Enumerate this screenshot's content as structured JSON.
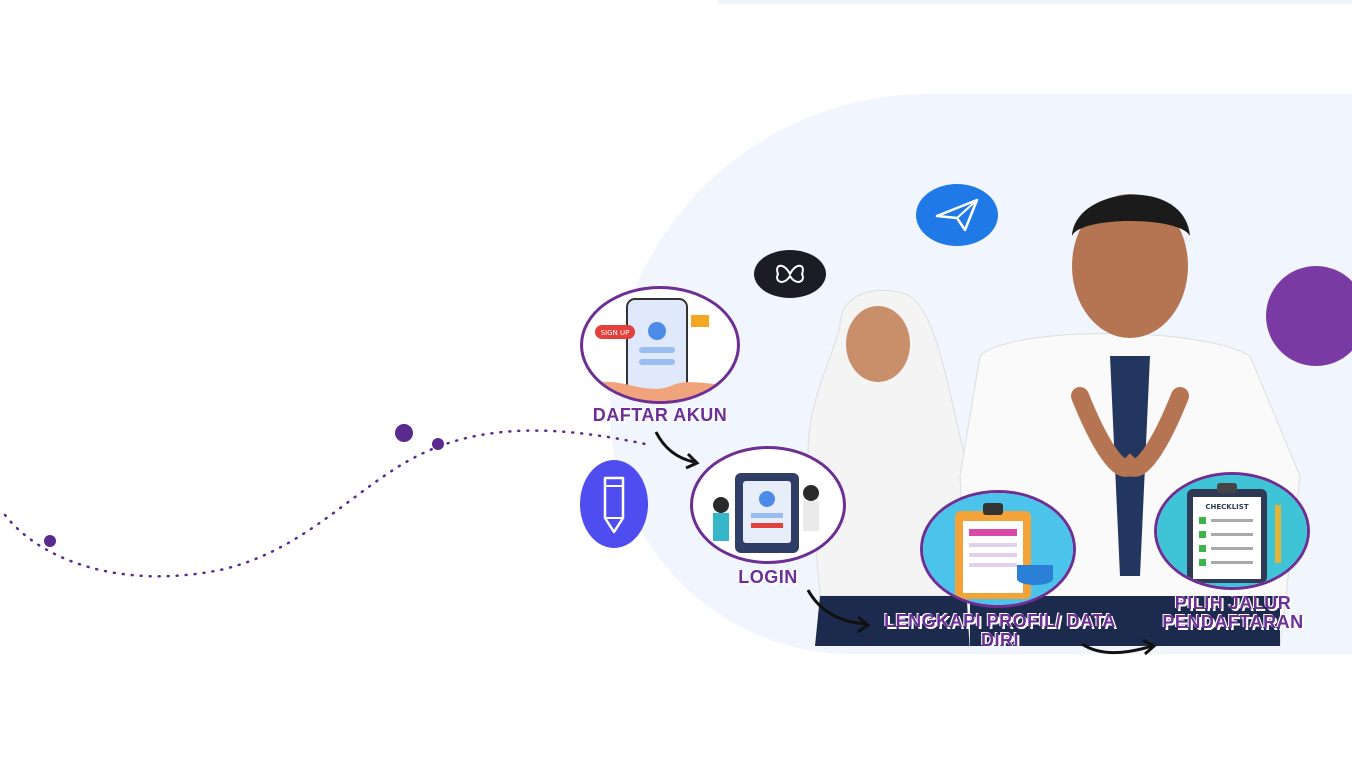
{
  "steps": [
    {
      "label": "DAFTAR AKUN"
    },
    {
      "label": "LOGIN"
    },
    {
      "label": "LENGKAPI PROFIL/ DATA DIRI"
    },
    {
      "label": "PILIH JALUR PENDAFTARAN"
    }
  ],
  "illustrations": {
    "signup_badge": "SIGN UP",
    "checklist_title": "CHECKLIST"
  },
  "colors": {
    "accent_purple": "#6b2f95",
    "background_blob": "#f1f5fd",
    "plane_blue": "#1f7ae8",
    "pencil_blue": "#4f4cf0"
  },
  "icons": [
    "paper-plane-icon",
    "butterfly-icon",
    "pencil-icon"
  ]
}
